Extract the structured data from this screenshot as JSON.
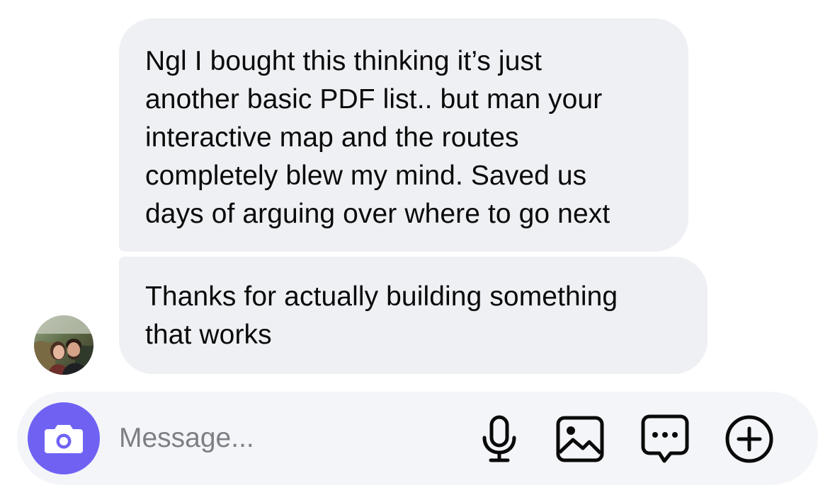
{
  "messages": [
    {
      "text": "Ngl I bought this thinking it’s just\nanother basic PDF list.. but man your\ninteractive map and the routes\ncompletely blew my mind. Saved us\ndays of arguing over where to go next"
    },
    {
      "text": "Thanks for actually building something\nthat works"
    }
  ],
  "composer": {
    "placeholder": "Message...",
    "icons": [
      "camera-icon",
      "microphone-icon",
      "image-icon",
      "chat-bubble-icon",
      "plus-circle-icon"
    ]
  },
  "colors": {
    "bubble": "#eff0f4",
    "composer": "#f4f5f8",
    "camera_button": "#6f62f3",
    "placeholder": "#7d7f86"
  }
}
